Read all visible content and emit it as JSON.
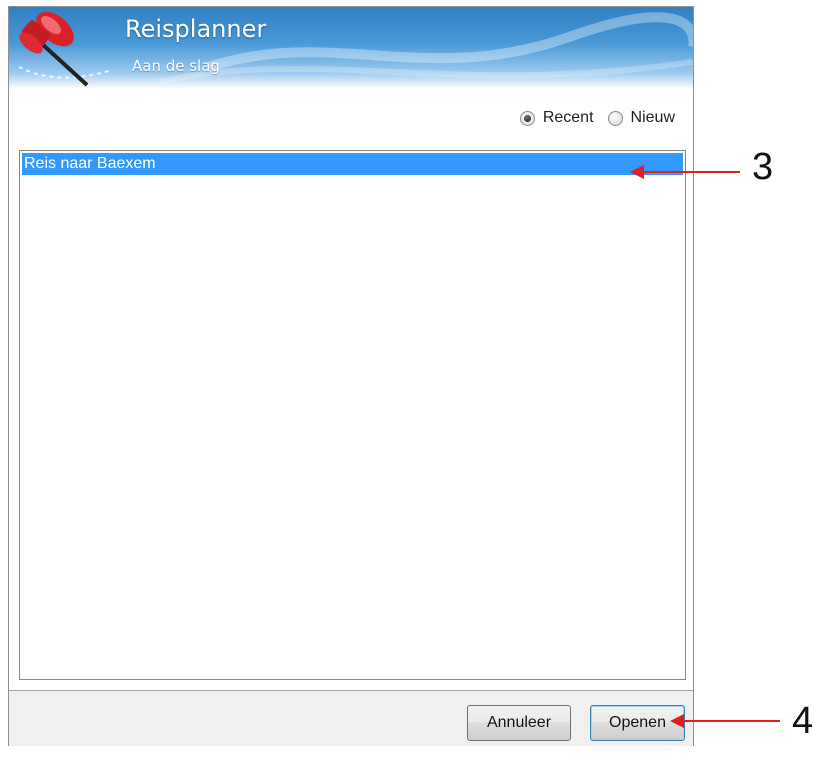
{
  "dialog": {
    "title": "Reisplanner",
    "subtitle": "Aan de slag",
    "mode_options": [
      {
        "label": "Recent",
        "checked": true
      },
      {
        "label": "Nieuw",
        "checked": false
      }
    ],
    "trips": [
      {
        "name": "Reis naar Baexem",
        "selected": true
      }
    ],
    "buttons": {
      "cancel_label": "Annuleer",
      "open_label": "Openen"
    }
  },
  "annotations": {
    "list_item_marker": "3",
    "open_button_marker": "4"
  },
  "colors": {
    "banner_blue": "#2f7fc4",
    "selection": "#3399ff",
    "annotation_red": "#e02020"
  },
  "icons": [
    "pushpin-icon"
  ]
}
